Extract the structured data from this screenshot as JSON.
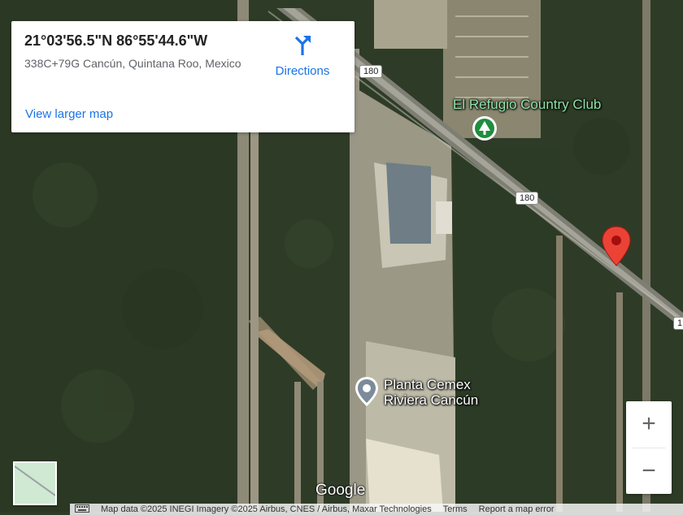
{
  "info_card": {
    "coordinates": "21°03'56.5\"N 86°55'44.6\"W",
    "address": "338C+79G Cancún, Quintana Roo, Mexico",
    "directions_label": "Directions",
    "view_larger_label": "View larger map"
  },
  "map": {
    "road_shields": [
      "180",
      "180",
      "1"
    ],
    "places": [
      {
        "name": "El Refugio Country Club",
        "icon": "park-tree-icon"
      },
      {
        "name": "Planta Cemex Riviera Cancún",
        "icon": "place-pin-icon"
      }
    ],
    "marker_icon": "red-location-pin-icon"
  },
  "controls": {
    "zoom_in": "+",
    "zoom_out": "−"
  },
  "branding": {
    "logo": "Google"
  },
  "footer": {
    "keyboard_icon": "keyboard-icon",
    "map_data": "Map data ©2025 INEGI Imagery ©2025 Airbus, CNES / Airbus, Maxar Technologies",
    "terms": "Terms",
    "report": "Report a map error"
  },
  "colors": {
    "link_blue": "#1a73e8",
    "marker_red": "#ea4335",
    "park_green": "#1e8e3e"
  }
}
